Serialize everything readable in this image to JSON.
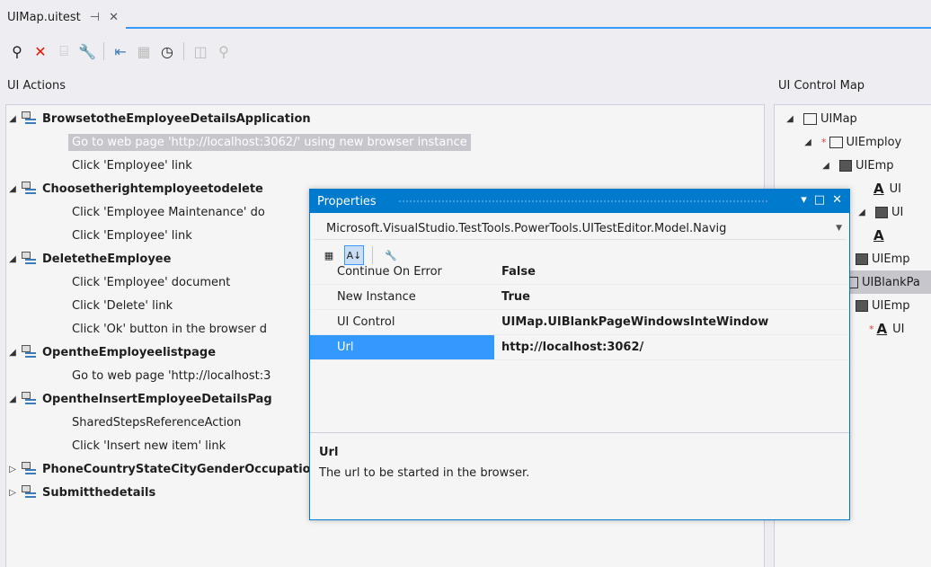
{
  "tab": {
    "title": "UIMap.uitest",
    "pin": "⊣",
    "close": "✕"
  },
  "toolbar": {
    "find": "⚲",
    "delete": "✕",
    "split": "⌸",
    "properties": "🔧",
    "move": "⇤",
    "insert": "▦",
    "delay": "◷",
    "locate": "◫",
    "search": "⚲"
  },
  "panes": {
    "left_title": "UI Actions",
    "right_title": "UI Control Map"
  },
  "actions": [
    {
      "type": "group",
      "label": "BrowsetotheEmployeeDetailsApplication",
      "expanded": true
    },
    {
      "type": "action",
      "label": "Go to web page 'http://localhost:3062/' using new browser instance",
      "selected": true
    },
    {
      "type": "action",
      "label": "Click 'Employee' link"
    },
    {
      "type": "group",
      "label": "Choosetherightemployeetodelete",
      "expanded": true
    },
    {
      "type": "action",
      "label": "Click 'Employee Maintenance' do"
    },
    {
      "type": "action",
      "label": "Click 'Employee' link"
    },
    {
      "type": "group",
      "label": "DeletetheEmployee",
      "expanded": true
    },
    {
      "type": "action",
      "label": "Click 'Employee' document"
    },
    {
      "type": "action",
      "label": "Click 'Delete' link"
    },
    {
      "type": "action",
      "label": "Click 'Ok' button in the browser d"
    },
    {
      "type": "group",
      "label": "OpentheEmployeelistpage",
      "expanded": true
    },
    {
      "type": "action",
      "label": "Go to web page 'http://localhost:3"
    },
    {
      "type": "group",
      "label": "OpentheInsertEmployeeDetailsPag",
      "expanded": true
    },
    {
      "type": "action",
      "label": "SharedStepsReferenceAction"
    },
    {
      "type": "action",
      "label": "Click 'Insert new item' link"
    },
    {
      "type": "group",
      "label": "PhoneCountryStateCityGenderOccupationDepartmentFirst_NameLast_NameMiddle_Name",
      "expanded": false
    },
    {
      "type": "group",
      "label": "Submitthedetails",
      "expanded": false
    }
  ],
  "control_map": [
    {
      "label": "UIMap",
      "arrow": "◢",
      "icon": "window"
    },
    {
      "label": "UIEmploy",
      "arrow": "◢",
      "icon": "window",
      "required": true
    },
    {
      "label": "UIEmp",
      "arrow": "◢",
      "icon": "control"
    },
    {
      "label": "UI",
      "icon": "text"
    },
    {
      "label": "UI",
      "arrow": "◢",
      "icon": "control"
    },
    {
      "label": "",
      "icon": "text"
    },
    {
      "label": "UIEmp",
      "icon": "control"
    },
    {
      "label": "UIBlankPa",
      "icon": "window",
      "selected": true
    },
    {
      "label": "UIEmp",
      "icon": "control"
    },
    {
      "label": "UI",
      "icon": "text",
      "required": true
    }
  ],
  "properties": {
    "title": "Properties",
    "object_type": "Microsoft.VisualStudio.TestTools.PowerTools.UITestEditor.Model.Navig",
    "rows": [
      {
        "name": "Continue On Error",
        "value": "False"
      },
      {
        "name": "New Instance",
        "value": "True"
      },
      {
        "name": "UI Control",
        "value": "UIMap.UIBlankPageWindowsInteWindow"
      },
      {
        "name": "Url",
        "value": "http://localhost:3062/",
        "selected": true
      }
    ],
    "description_title": "Url",
    "description_text": "The url to be started in the browser."
  }
}
